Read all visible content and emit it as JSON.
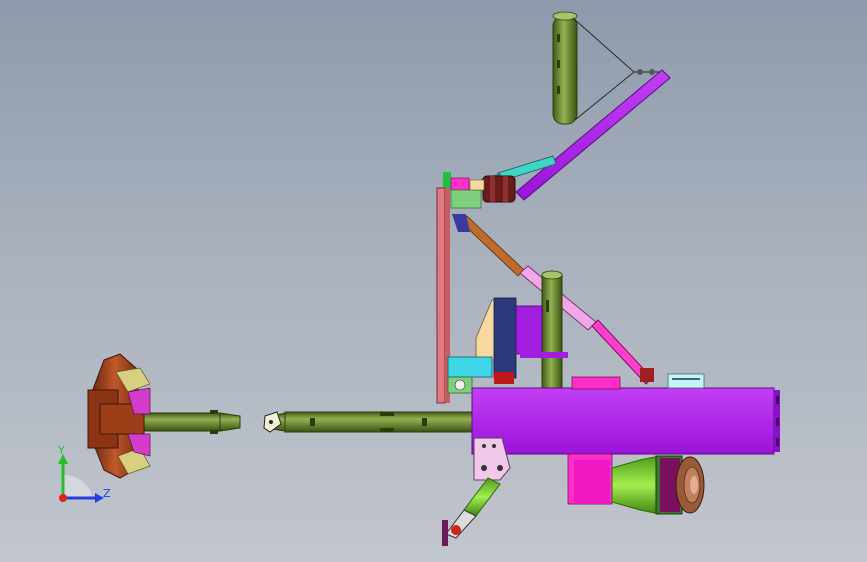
{
  "viewport": {
    "background_top": "#8e9aab",
    "background_bottom": "#c2c6cd"
  },
  "triad": {
    "y_label": "Y",
    "z_label": "Z",
    "y_color": "#22c02a",
    "z_color": "#2540e0",
    "x_color": "#e02020"
  },
  "colors": {
    "olive": "#6b8a2e",
    "magenta": "#b224e8",
    "pink": "#ff2fc8",
    "rust": "#a84a22",
    "teal": "#36d6c8",
    "salmon": "#e0787c",
    "lime": "#8ee040",
    "cream": "#f5d9a0"
  }
}
